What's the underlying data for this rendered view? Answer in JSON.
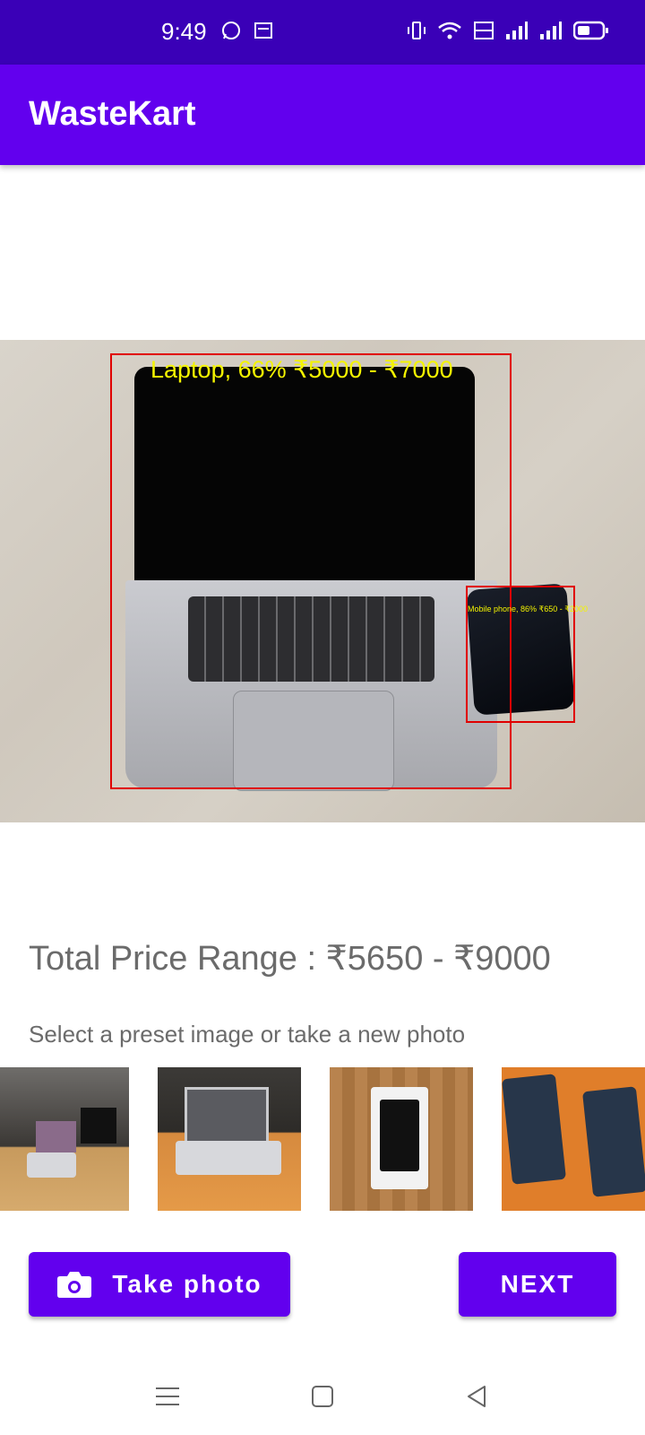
{
  "status_bar": {
    "time": "9:49",
    "left_icons": [
      "whatsapp-icon",
      "news-app-icon"
    ],
    "right_icons": [
      "vibrate-icon",
      "wifi-icon",
      "volte-icon",
      "signal-icon",
      "signal-icon",
      "battery-icon"
    ],
    "background": "#3a00b7"
  },
  "app_bar": {
    "title": "WasteKart",
    "background": "#6200ee"
  },
  "result_image": {
    "detections": [
      {
        "label": "Laptop, 66% ₹5000 - ₹7000",
        "box_color": "#e00000",
        "text_color": "#f4f400"
      },
      {
        "label": "Mobile phone, 86% ₹650 - ₹2000",
        "box_color": "#e00000",
        "text_color": "#f4f400"
      }
    ]
  },
  "total_price_text": "Total Price Range : ₹5650 - ₹9000",
  "instruction_text": "Select a preset image or take a new photo",
  "presets": [
    {
      "name": "preset-desk-setup"
    },
    {
      "name": "preset-laptop"
    },
    {
      "name": "preset-phone-box"
    },
    {
      "name": "preset-two-phones"
    }
  ],
  "buttons": {
    "take_photo": "Take photo",
    "next": "NEXT",
    "accent": "#6200ee"
  },
  "nav_bar": [
    "menu-icon",
    "home-square-icon",
    "back-triangle-icon"
  ]
}
